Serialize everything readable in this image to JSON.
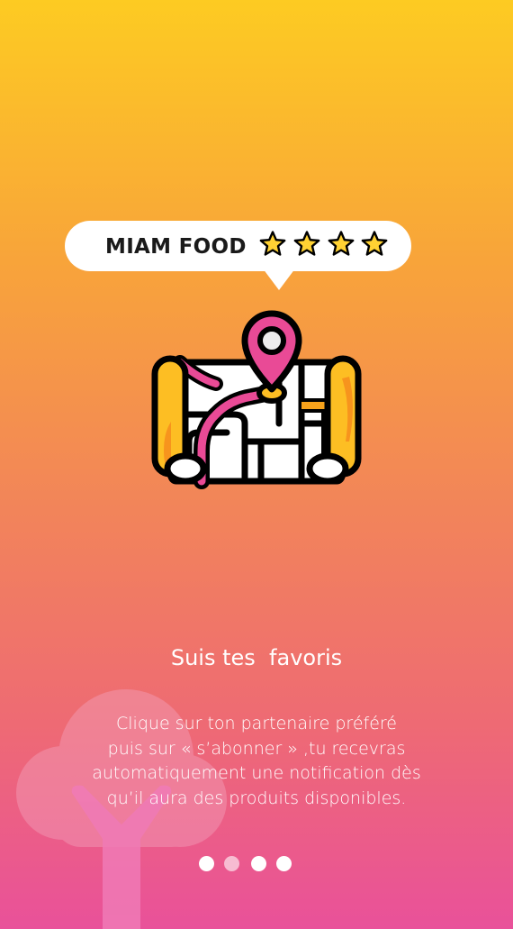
{
  "bubble": {
    "brand": "MIAM FOOD",
    "stars": [
      {
        "icon": "star-icon"
      },
      {
        "icon": "star-icon"
      },
      {
        "icon": "star-icon"
      },
      {
        "icon": "star-icon"
      }
    ]
  },
  "illustration": {
    "icon": "map-with-location-pin-icon"
  },
  "onboarding": {
    "title": "Suis tes  favoris",
    "description_lines": [
      "Clique sur ton partenaire préféré",
      "puis sur « s’abonner » ,tu recevras",
      "automatiquement une notification dès",
      "qu’il aura des produits disponibles."
    ]
  },
  "pagination": {
    "total": 4,
    "active_index": 0
  },
  "colors": {
    "gradient_top": "#FDCB22",
    "gradient_bottom": "#E9519A",
    "pin": "#E94A96",
    "star": "#FFD233",
    "outline": "#000000"
  }
}
